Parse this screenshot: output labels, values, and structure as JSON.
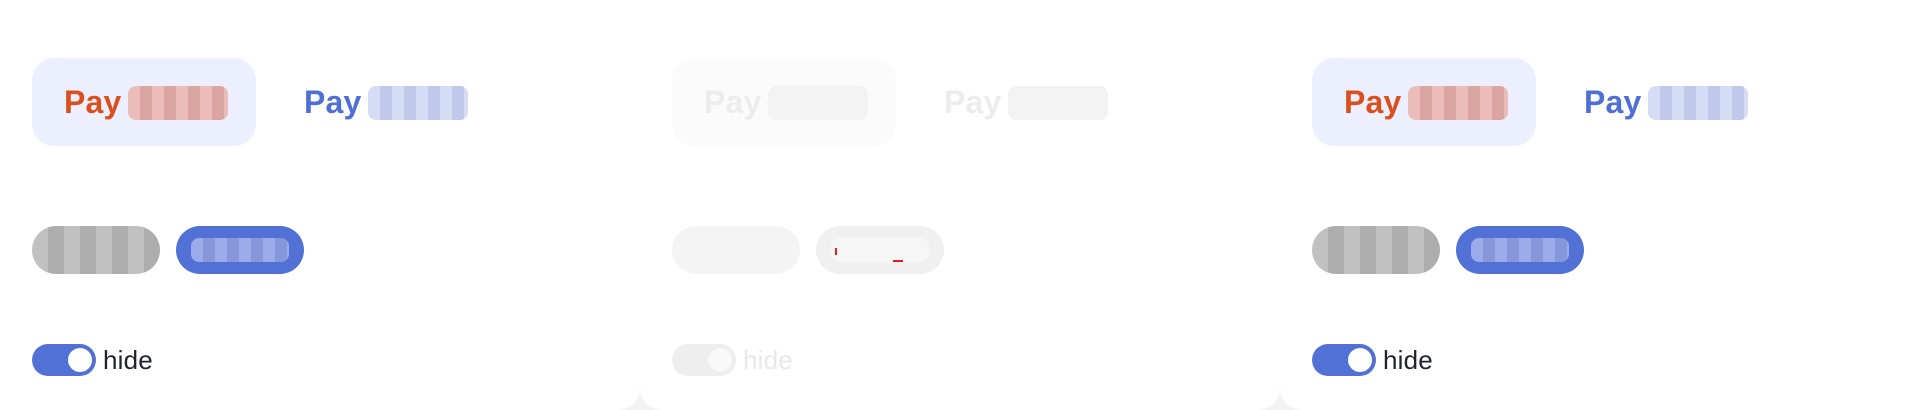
{
  "panels": [
    {
      "state": "enabled",
      "tabs": {
        "active_label": "Pay",
        "inactive_label": "Pay"
      },
      "buttons": {
        "secondary_label": "",
        "primary_label": ""
      },
      "toggle": {
        "label": "hide",
        "on": true
      }
    },
    {
      "state": "disabled",
      "tabs": {
        "active_label": "Pay",
        "inactive_label": "Pay"
      },
      "buttons": {
        "secondary_label": "",
        "primary_label": ""
      },
      "toggle": {
        "label": "hide",
        "on": true
      }
    },
    {
      "state": "enabled",
      "tabs": {
        "active_label": "Pay",
        "inactive_label": "Pay"
      },
      "buttons": {
        "secondary_label": "",
        "primary_label": ""
      },
      "toggle": {
        "label": "hide",
        "on": true
      }
    }
  ],
  "colors": {
    "accent_blue": "#5271d6",
    "pay_orange": "#d94f1e",
    "pay_blue": "#4f6fd6",
    "active_tab_bg": "#eceffd",
    "pill_grey": "#b8b8b8",
    "background": "#f3f3f4"
  }
}
